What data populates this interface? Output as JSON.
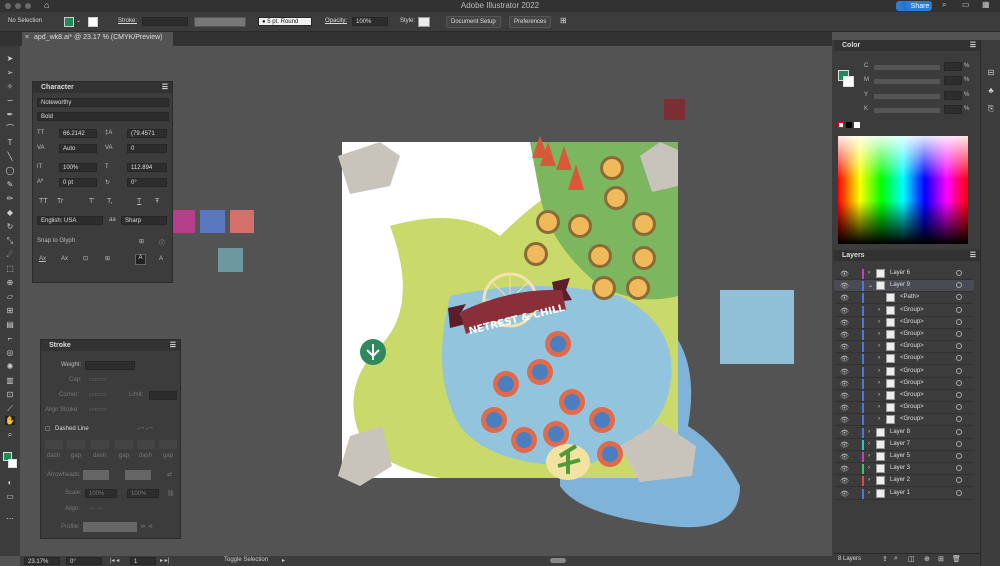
{
  "app_title": "Adobe Illustrator 2022",
  "share_label": "Share",
  "control_bar": {
    "selection": "No Selection",
    "stroke_label": "Stroke:",
    "brush": "5 pt. Round",
    "opacity_label": "Opacity:",
    "opacity_value": "100%",
    "style_label": "Style:",
    "document_setup": "Document Setup",
    "preferences": "Preferences"
  },
  "document_tab": "apd_wk8.ai* @ 23.17 % (CMYK/Preview)",
  "character_panel": {
    "title": "Character",
    "font": "Noteworthy",
    "weight": "Bold",
    "size": "66.2142",
    "leading": "(79.4571",
    "kerning": "Auto",
    "tracking": "0",
    "vscale": "100%",
    "hscale": "112.894",
    "baseline": "0 pt",
    "rotation": "0°",
    "language": "English: USA",
    "aa": "Sharp",
    "snap": "Snap to Glyph",
    "t1": "TT",
    "t2": "Tr",
    "t3": "T'",
    "t4": "T,",
    "t5": "T",
    "t6": "Ŧ",
    "a1": "Ax",
    "a2": "Ax",
    "a4": "A",
    "a5": "A"
  },
  "stroke_panel": {
    "title": "Stroke",
    "weight_label": "Weight:",
    "cap_label": "Cap:",
    "corner_label": "Corner:",
    "limit_label": "Limit:",
    "align_stroke_label": "Align Stroke:",
    "dashed_line": "Dashed Line",
    "dash": "dash",
    "gap": "gap",
    "arrowheads": "Arrowheads:",
    "scale": "Scale:",
    "align": "Align:",
    "profile": "Profile:",
    "scale_a": "100%",
    "scale_b": "100%"
  },
  "color_panel": {
    "title": "Color",
    "c": "C",
    "m": "M",
    "y": "Y",
    "k": "K",
    "pct": "%"
  },
  "layers_panel": {
    "title": "Layers",
    "count": "8 Layers",
    "rows": [
      {
        "name": "Layer 6",
        "color": "#c83cc8"
      },
      {
        "name": "Layer 9",
        "color": "#4a7ad8"
      },
      {
        "name": "<Path>",
        "color": "#4a7ad8"
      },
      {
        "name": "<Group>",
        "color": "#4a7ad8"
      },
      {
        "name": "<Group>",
        "color": "#4a7ad8"
      },
      {
        "name": "<Group>",
        "color": "#4a7ad8"
      },
      {
        "name": "<Group>",
        "color": "#4a7ad8"
      },
      {
        "name": "<Group>",
        "color": "#4a7ad8"
      },
      {
        "name": "<Group>",
        "color": "#4a7ad8"
      },
      {
        "name": "<Group>",
        "color": "#4a7ad8"
      },
      {
        "name": "<Group>",
        "color": "#4a7ad8"
      },
      {
        "name": "<Group>",
        "color": "#4a7ad8"
      },
      {
        "name": "<Group>",
        "color": "#4a7ad8"
      },
      {
        "name": "Layer 8",
        "color": "#4a7ad8"
      },
      {
        "name": "Layer 7",
        "color": "#2cc8c8"
      },
      {
        "name": "Layer 5",
        "color": "#c83cc8"
      },
      {
        "name": "Layer 3",
        "color": "#3ac86a"
      },
      {
        "name": "Layer 2",
        "color": "#e04a4a"
      },
      {
        "name": "Layer 1",
        "color": "#4a7ad8"
      }
    ]
  },
  "artwork": {
    "banner_text": "NETREST & CHILL"
  },
  "status": {
    "zoom": "23.17%",
    "rotation": "0°",
    "artboard": "1",
    "tool": "Toggle Selection"
  }
}
